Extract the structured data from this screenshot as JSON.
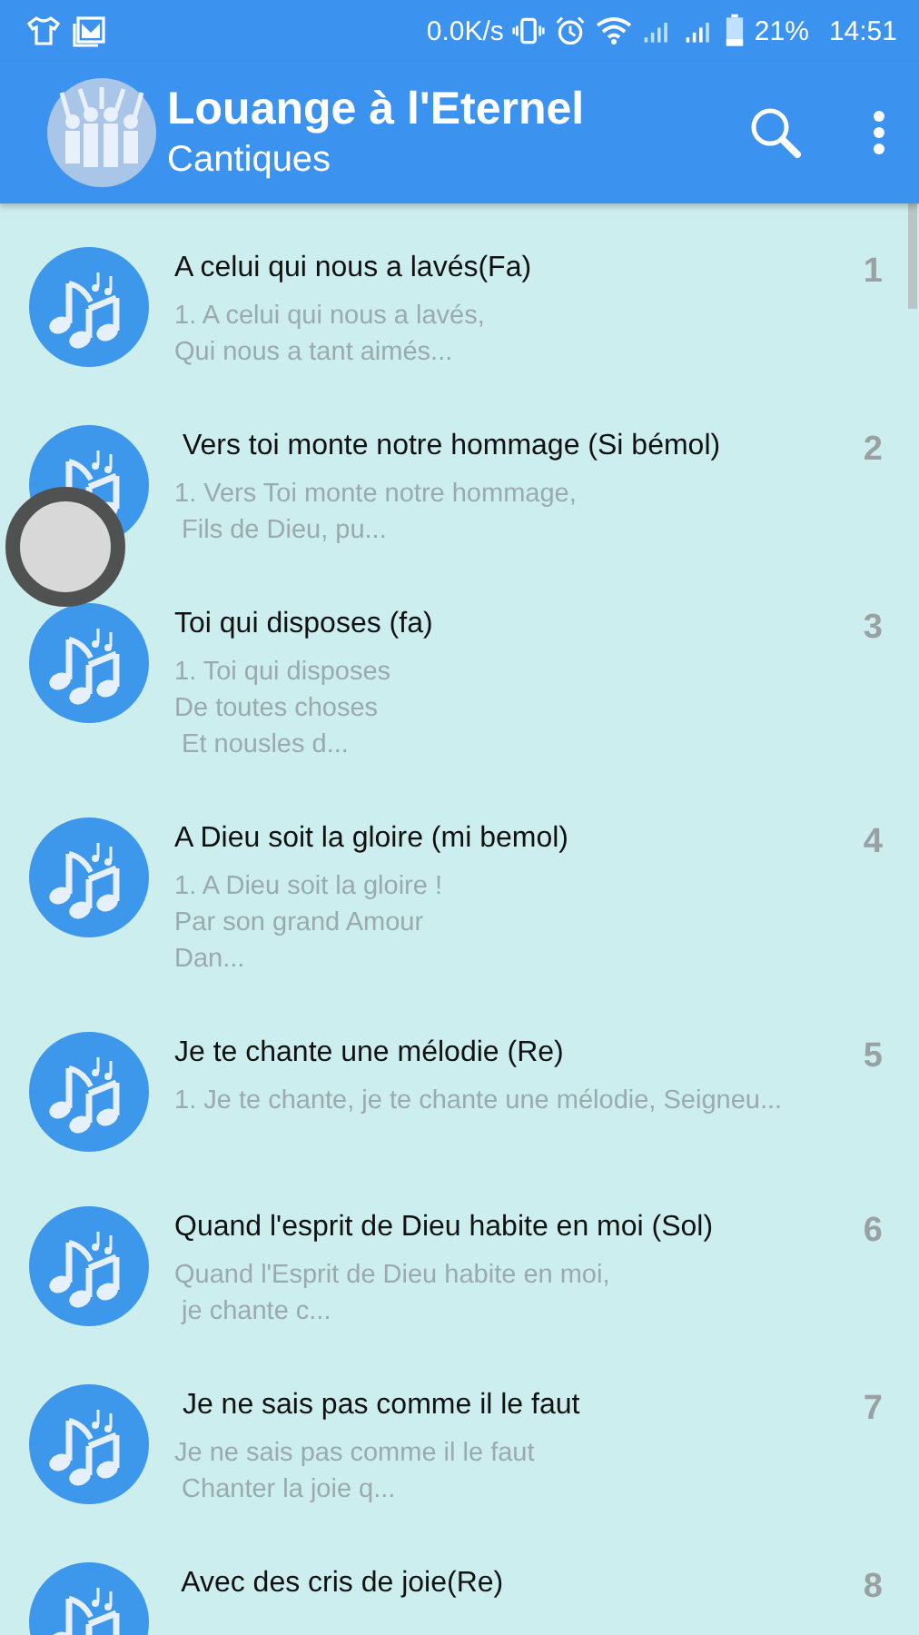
{
  "status_bar": {
    "speed": "0.0K/s",
    "battery_percent": "21%",
    "time": "14:51"
  },
  "app_bar": {
    "title": "Louange à l'Eternel",
    "subtitle": "Cantiques"
  },
  "songs": [
    {
      "title": "A celui qui nous a lavés(Fa)",
      "preview": [
        "1. A celui qui nous a lavés,",
        "Qui nous a tant aimés..."
      ],
      "number": "1"
    },
    {
      "title": " Vers toi monte notre hommage (Si bémol)",
      "preview": [
        "1. Vers Toi monte notre hommage,",
        " Fils de Dieu, pu..."
      ],
      "number": "2"
    },
    {
      "title": "Toi qui disposes (fa)",
      "preview": [
        "1. Toi qui disposes",
        "De toutes choses",
        " Et nousles d..."
      ],
      "number": "3"
    },
    {
      "title": "A Dieu soit la gloire (mi bemol)",
      "preview": [
        "1. A Dieu soit la gloire !",
        "Par son grand Amour",
        "Dan..."
      ],
      "number": "4"
    },
    {
      "title": "Je te chante une mélodie (Re)",
      "preview": [
        "1. Je te chante, je te chante une mélodie, Seigneu..."
      ],
      "number": "5"
    },
    {
      "title": "Quand l'esprit de Dieu habite en moi (Sol)",
      "preview": [
        "Quand l'Esprit de Dieu habite en moi,",
        " je chante c..."
      ],
      "number": "6"
    },
    {
      "title": " Je ne sais pas comme il le faut",
      "preview": [
        "Je ne sais pas comme il le faut",
        " Chanter la joie q..."
      ],
      "number": "7"
    },
    {
      "title": " Avec des cris de joie(Re)",
      "number": "8"
    }
  ]
}
